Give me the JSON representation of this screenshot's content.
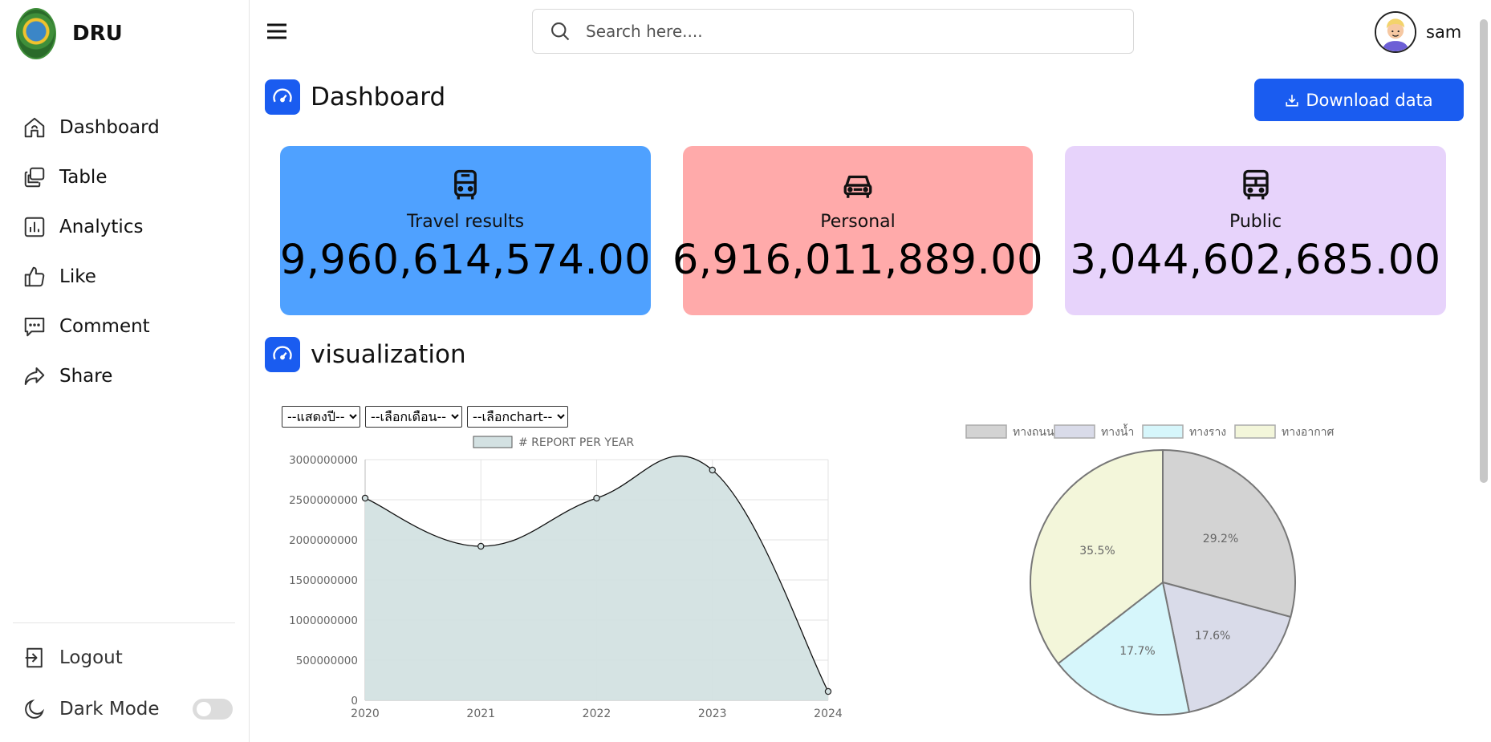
{
  "brand": {
    "name": "DRU"
  },
  "sidebar": {
    "items": [
      {
        "label": "Dashboard",
        "icon": "home-icon"
      },
      {
        "label": "Table",
        "icon": "layers-icon"
      },
      {
        "label": "Analytics",
        "icon": "bar-chart-icon"
      },
      {
        "label": "Like",
        "icon": "thumbs-up-icon"
      },
      {
        "label": "Comment",
        "icon": "comment-icon"
      },
      {
        "label": "Share",
        "icon": "share-icon"
      }
    ],
    "logout_label": "Logout",
    "dark_mode_label": "Dark Mode",
    "dark_mode_on": false
  },
  "search": {
    "placeholder": "Search here...."
  },
  "user": {
    "name": "sam"
  },
  "dashboard": {
    "title": "Dashboard",
    "download_label": "Download data",
    "accent": "#1a5cf0"
  },
  "cards": [
    {
      "label": "Travel results",
      "value": "9,960,614,574.00",
      "icon": "bus-front-icon",
      "color": "#4fa1ff"
    },
    {
      "label": "Personal",
      "value": "6,916,011,889.00",
      "icon": "car-icon",
      "color": "#ffaaaa"
    },
    {
      "label": "Public",
      "value": "3,044,602,685.00",
      "icon": "bus-icon",
      "color": "#e7d3fb"
    }
  ],
  "visualization": {
    "title": "visualization"
  },
  "filters": {
    "year": "--แสดงปี--",
    "month": "--เลือกเดือน--",
    "chart": "--เลือกchart--"
  },
  "chart_data": [
    {
      "type": "area",
      "legend": "# REPORT PER YEAR",
      "x": [
        "2020",
        "2021",
        "2022",
        "2023",
        "2024"
      ],
      "values": [
        2520000000,
        1920000000,
        2520000000,
        2870000000,
        110000000
      ],
      "ylim": [
        0,
        3000000000
      ],
      "yticks": [
        0,
        500000000,
        1000000000,
        1500000000,
        2000000000,
        2500000000,
        3000000000
      ],
      "grid": true,
      "legend_position": "top",
      "fill_color": "#d3e1e2",
      "line_color": "#111111"
    },
    {
      "type": "pie",
      "labels": [
        "ทางถนน",
        "ทางน้ำ",
        "ทางราง",
        "ทางอากาศ"
      ],
      "values": [
        29.2,
        17.6,
        17.7,
        35.5
      ],
      "value_labels": [
        "29.2%",
        "17.6%",
        "17.7%",
        "35.5%"
      ],
      "colors": [
        "#d3d3d3",
        "#d9dbe9",
        "#d6f6fb",
        "#f3f6da"
      ],
      "legend_position": "top"
    }
  ]
}
